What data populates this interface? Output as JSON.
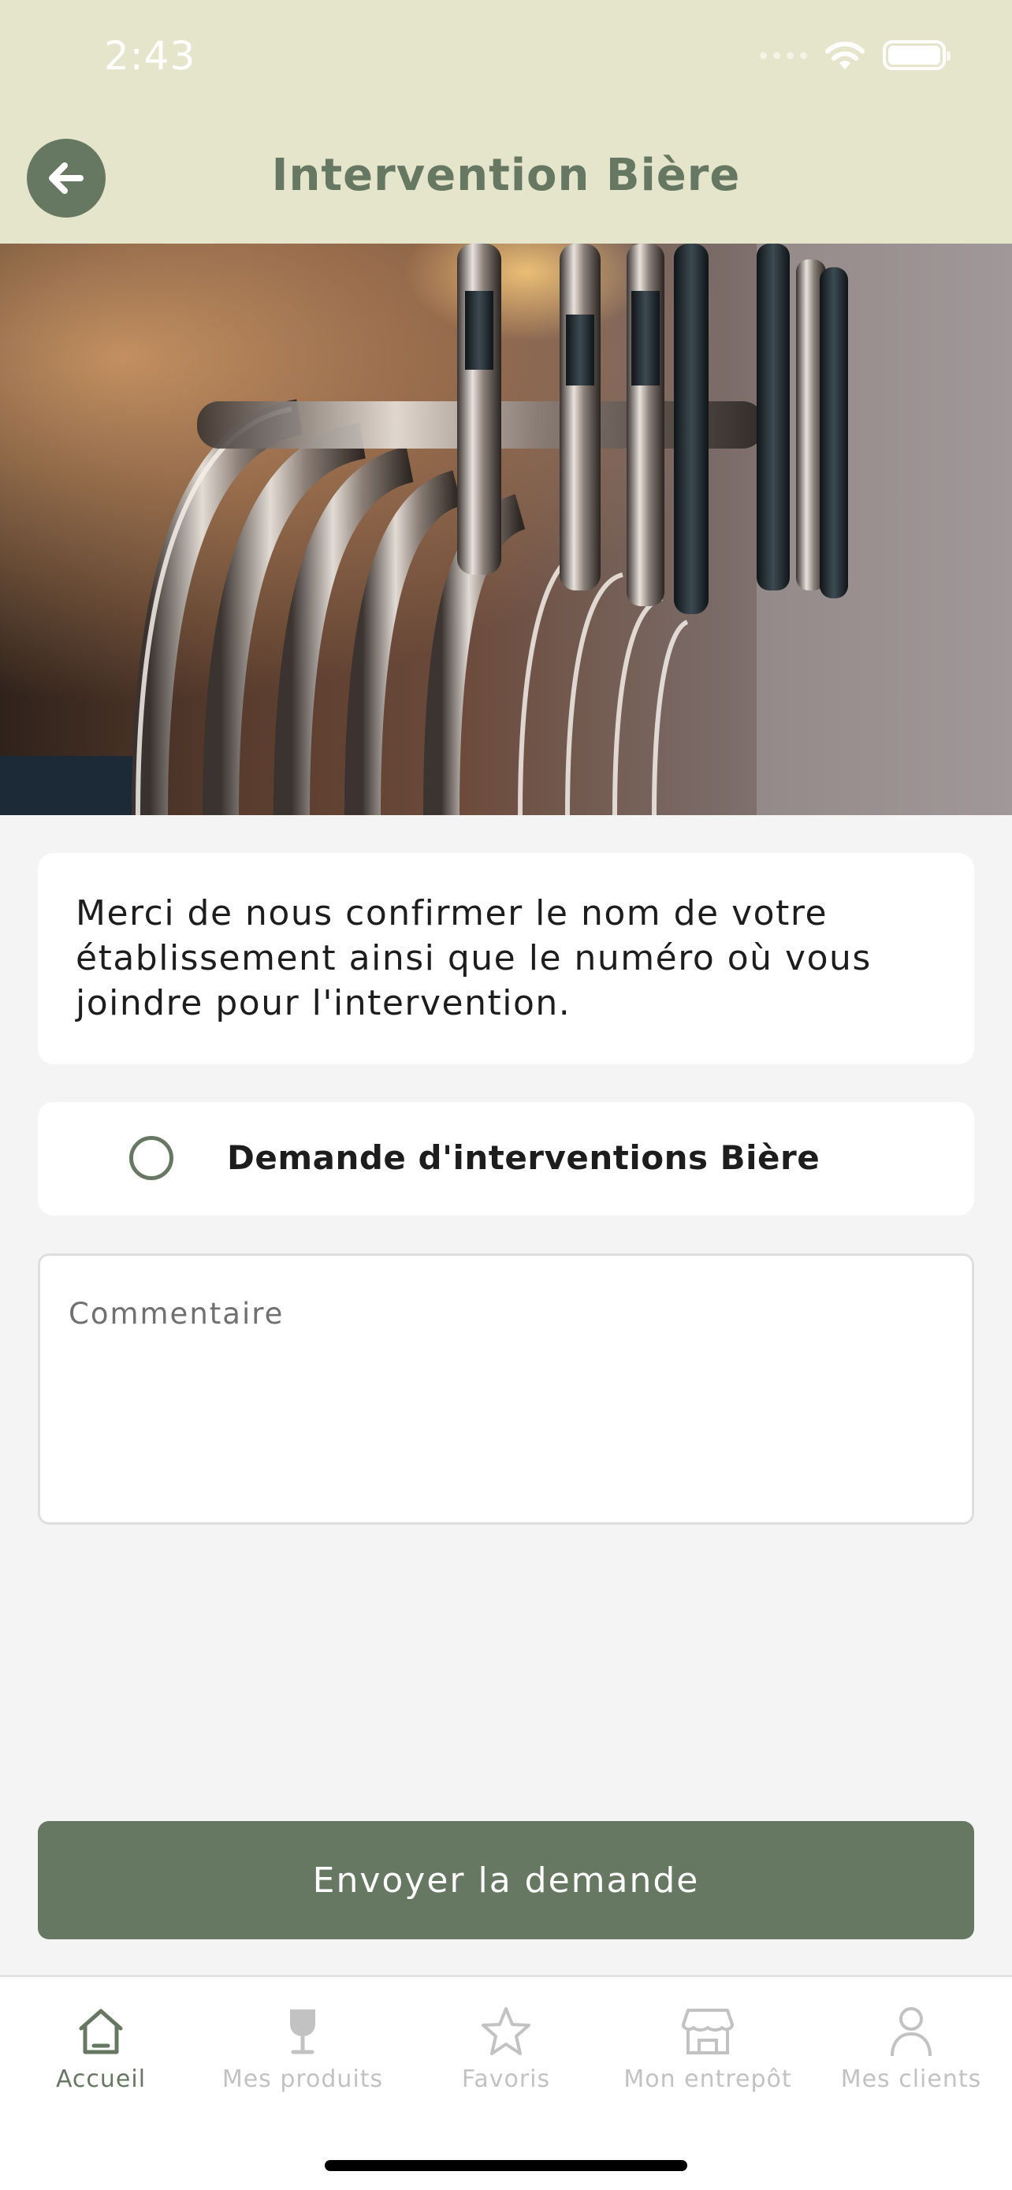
{
  "status_bar": {
    "time": "2:43"
  },
  "header": {
    "title": "Intervention Bière"
  },
  "info": {
    "text": "Merci de nous confirmer le nom de votre établissement ainsi que le numéro où vous joindre pour l'intervention."
  },
  "option": {
    "label": "Demande d'interventions Bière",
    "selected": false
  },
  "comment": {
    "placeholder": "Commentaire",
    "value": ""
  },
  "submit": {
    "label": "Envoyer la demande"
  },
  "tabs": [
    {
      "label": "Accueil",
      "icon": "home-icon",
      "active": true
    },
    {
      "label": "Mes produits",
      "icon": "wine-glass-icon",
      "active": false
    },
    {
      "label": "Favoris",
      "icon": "star-icon",
      "active": false
    },
    {
      "label": "Mon entrepôt",
      "icon": "store-icon",
      "active": false
    },
    {
      "label": "Mes clients",
      "icon": "user-icon",
      "active": false
    }
  ],
  "colors": {
    "header_bg": "#e5e5cc",
    "accent": "#667861",
    "page_bg": "#f4f4f4",
    "tab_inactive": "#c2c2c2"
  }
}
